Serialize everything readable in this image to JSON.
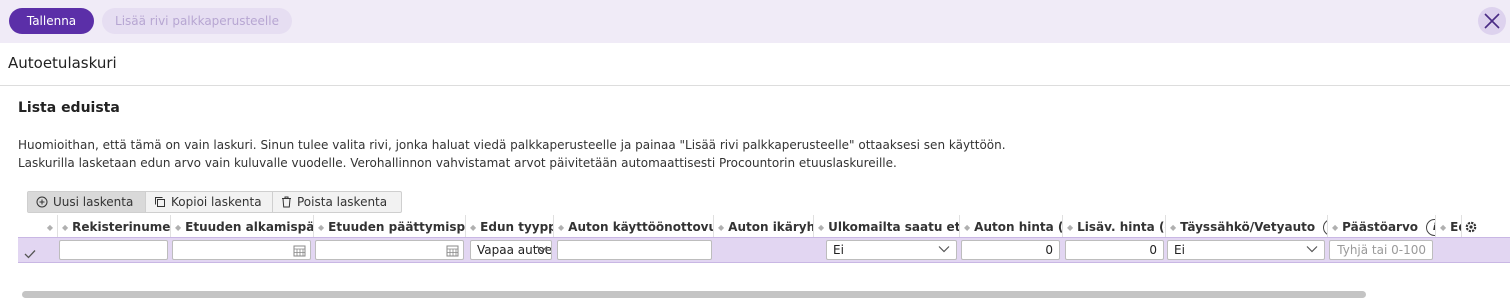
{
  "topbar": {
    "save_label": "Tallenna",
    "add_label": "Lisää rivi palkkaperusteelle",
    "close_icon": "close-icon"
  },
  "page": {
    "title": "Autoetulaskuri"
  },
  "section": {
    "title": "Lista eduista",
    "desc_line1": "Huomioithan, että tämä on vain laskuri. Sinun tulee valita rivi, jonka haluat viedä palkkaperusteelle ja painaa \"Lisää rivi palkkaperusteelle\" ottaaksesi sen käyttöön.",
    "desc_line2": "Laskurilla lasketaan edun arvo vain kuluvalle vuodelle. Verohallinnon vahvistamat arvot päivitetään automaattisesti Procountorin etuuslaskureille."
  },
  "toolbar": {
    "new_label": "Uusi laskenta",
    "copy_label": "Kopioi laskenta",
    "delete_label": "Poista laskenta"
  },
  "grid": {
    "headers": {
      "reg": "Rekisterinumero",
      "start": "Etuuden alkamispäivä",
      "end": "Etuuden päättymispäivä",
      "type": "Edun tyyppi",
      "year": "Auton käyttöönottovuosi",
      "age": "Auton ikäryhmä",
      "abroad": "Ulkomailta saatu etu",
      "price": "Auton hinta (e)",
      "extra": "Lisäv. hinta (e)",
      "electric": "Täyssähkö/Vetyauto",
      "emission": "Päästöarvo",
      "last": "Ed"
    },
    "row": {
      "reg": "",
      "start": "",
      "end": "",
      "type": "Vapaa autoetu",
      "year": "",
      "age": "",
      "abroad": "Ei",
      "price": "0",
      "extra": "0",
      "electric": "Ei",
      "emission_placeholder": "Tyhjä tai 0-100"
    }
  }
}
